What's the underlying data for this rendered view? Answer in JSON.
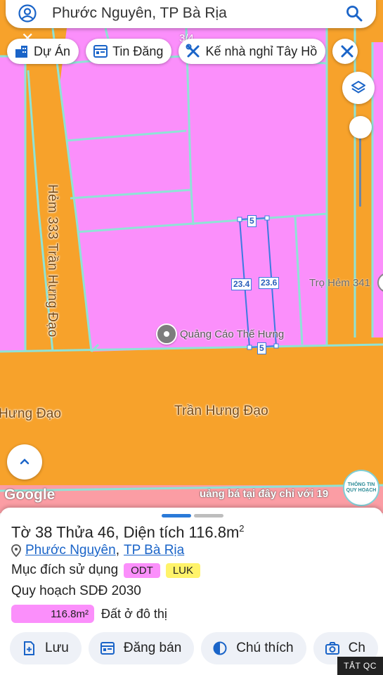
{
  "search": {
    "query": "Phước Nguyên, TP Bà Rịa"
  },
  "chips": [
    {
      "label": "Dự Án",
      "icon": "building-icon"
    },
    {
      "label": "Tin Đăng",
      "icon": "listing-icon"
    },
    {
      "label": "Kế nhà nghỉ Tây Hồ",
      "icon": "wrench-icon"
    }
  ],
  "page_indicator": "3/4",
  "map": {
    "streets": {
      "alley": "Hẻm 333 Trần Hưng Đạo",
      "main": "Trần Hưng Đạo",
      "main_left": "Hưng Đạo"
    },
    "pois": {
      "ad_shop": "Quảng Cáo Thế Hưng",
      "inn": "Trọ Hẻm 341"
    },
    "dimensions": {
      "top": "5",
      "bottom": "5",
      "left": "23.4",
      "right": "23.6"
    },
    "google_logo": "Google",
    "ad_banner": "uảng bá tại đây chỉ với 19",
    "info_badge": "THÔNG TIN QUY HOẠCH"
  },
  "colors": {
    "residential": "#fb8ffb",
    "road": "#f7a22b",
    "boundary": "#8fe3d6",
    "selection": "#3b7be0",
    "link": "#1a64c8"
  },
  "sheet": {
    "title_prefix": "Tờ 38 Thửa 46, Diện tích 116.8m",
    "title_sup": "2",
    "ward": "Phước Nguyên",
    "separator": ",",
    "city": "TP Bà Rịa",
    "purpose_label": "Mục đích sử dụng",
    "purpose_badges": [
      {
        "code": "ODT",
        "color": "#fb8ffb"
      },
      {
        "code": "LUK",
        "color": "#fff36a"
      }
    ],
    "plan_label": "Quy hoạch SDĐ 2030",
    "area_value": "116.8m²",
    "area_type": "Đất ở đô thị"
  },
  "actions": [
    {
      "label": "Lưu",
      "icon": "save-plus-icon"
    },
    {
      "label": "Đăng bán",
      "icon": "listing-icon"
    },
    {
      "label": "Chú thích",
      "icon": "legend-icon"
    },
    {
      "label": "Ch",
      "icon": "camera-icon"
    }
  ],
  "ads_label": "TẮT QC"
}
